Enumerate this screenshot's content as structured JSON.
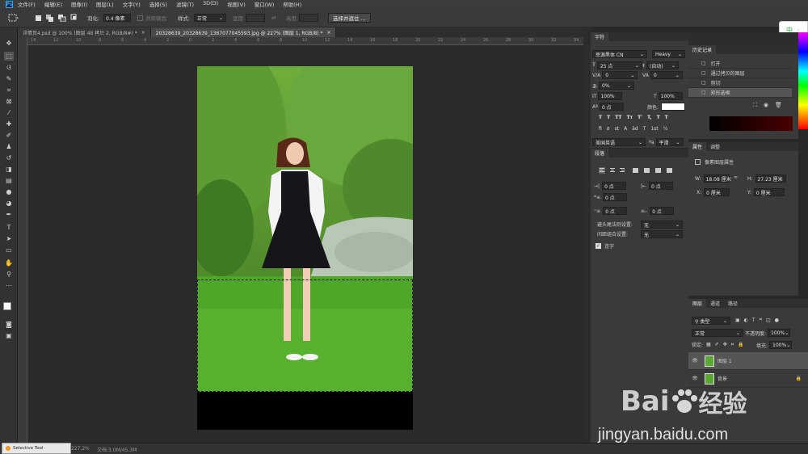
{
  "app": {
    "logo": "Ps"
  },
  "menu": [
    "文件(F)",
    "编辑(E)",
    "图像(I)",
    "图层(L)",
    "文字(Y)",
    "选择(S)",
    "滤镜(T)",
    "3D(D)",
    "视图(V)",
    "窗口(W)",
    "帮助(H)"
  ],
  "options": {
    "feather_label": "羽化:",
    "feather_value": "0.4 像素",
    "antialias_label": "消除锯齿",
    "style_label": "样式:",
    "style_value": "正常",
    "width_label": "宽度:",
    "height_label": "高度:",
    "select_mask_btn": "选择并遮住 ..."
  },
  "tabs": [
    {
      "label": "详情页4.psd @ 100% (图层 48 拷贝 2, RGB/8#) *",
      "active": false
    },
    {
      "label": "20328639_20328639_1367077045593.jpg @ 227% (图层 1, RGB/8) *",
      "active": true
    }
  ],
  "ruler_marks": [
    "14",
    "12",
    "10",
    "8",
    "6",
    "4",
    "2",
    "0",
    "2",
    "4",
    "6",
    "8",
    "10",
    "12",
    "14",
    "16",
    "18",
    "20",
    "22",
    "24",
    "26",
    "28",
    "30",
    "32",
    "34"
  ],
  "character": {
    "tab1": "字符",
    "font_family": "思源黑体 CN",
    "font_weight": "Heavy",
    "size": "25 点",
    "leading": "(自动)",
    "kerning": "0",
    "tracking": "0",
    "scale_pct": "0%",
    "vscale": "100%",
    "hscale": "100%",
    "baseline": "0 点",
    "color_label": "颜色:",
    "language": "美国英语",
    "aa": "平滑",
    "style_buttons": [
      "T",
      "T",
      "TT",
      "Tт",
      "T'",
      "T,",
      "T",
      "T"
    ],
    "ot_buttons": [
      "fi",
      "σ",
      "st",
      "A",
      "ād",
      "T",
      "1st",
      "½"
    ]
  },
  "paragraph": {
    "tab": "段落",
    "indent_left": "0 点",
    "indent_right": "0 点",
    "first_line": "0 点",
    "space_before": "0 点",
    "space_after": "0 点",
    "kinsoku_label": "避头尾法则设置:",
    "kinsoku_value": "无",
    "mojikumi_label": "间距组合设置:",
    "mojikumi_value": "无",
    "hyphen_label": "连字"
  },
  "history": {
    "tab": "历史记录",
    "items": [
      "打开",
      "通过拷贝的图层",
      "剪切",
      "矩形选框"
    ]
  },
  "properties": {
    "tab": "属性",
    "tab2": "调整",
    "subtitle": "像素图层属性",
    "w_label": "W:",
    "w": "18.08 厘米",
    "h_label": "H:",
    "h": "27.23 厘米",
    "x_label": "X:",
    "x": "0 厘米",
    "y_label": "Y:",
    "y": "0 厘米"
  },
  "layers": {
    "tabs": [
      "图层",
      "通道",
      "路径"
    ],
    "filter": "类型",
    "blend": "正常",
    "opacity_label": "不透明度:",
    "opacity": "100%",
    "lock_label": "锁定:",
    "fill_label": "填充:",
    "fill": "100%",
    "items": [
      {
        "name": "图层 1",
        "selected": true
      },
      {
        "name": "背景",
        "selected": false
      }
    ]
  },
  "status": {
    "zoom": "227.2%",
    "doc": "文档:3.0M/45.3M",
    "selective": "Selective Tool"
  },
  "ime": "中",
  "watermark": {
    "brand": "Bai",
    "brand2": "经验",
    "url": "jingyan.baidu.com"
  },
  "colors": {
    "accent": "#31a8ff",
    "panel": "#3a3a3a",
    "canvas": "#2a2a2a"
  }
}
